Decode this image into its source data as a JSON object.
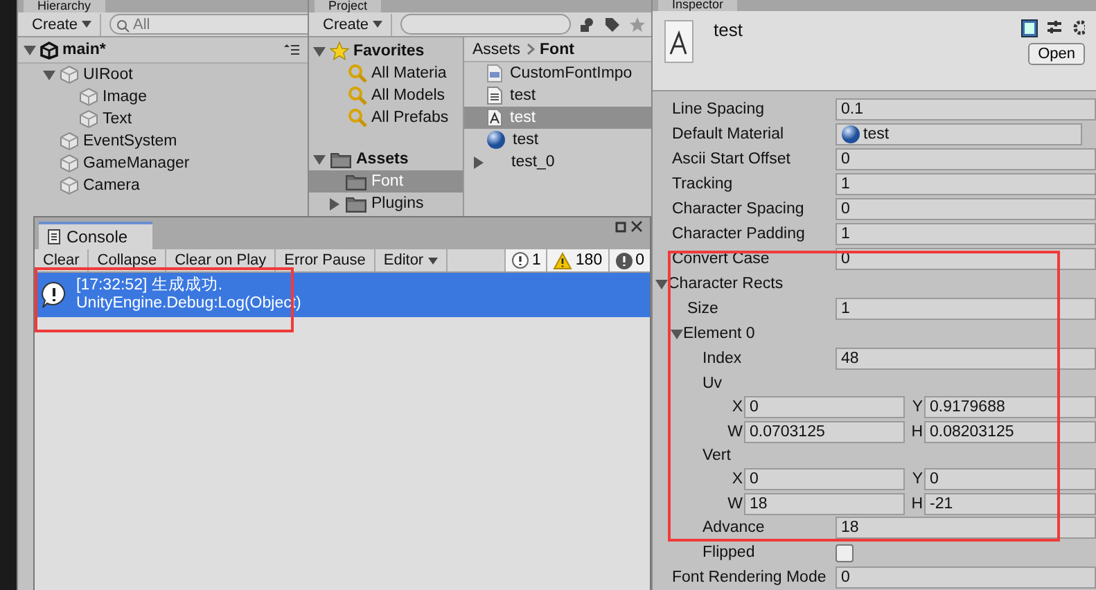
{
  "hierarchy": {
    "tab": "Hierarchy",
    "create": "Create",
    "search_placeholder": "All",
    "scene": "main*",
    "items": [
      {
        "label": "UIRoot",
        "expanded": true,
        "children": [
          {
            "label": "Image"
          },
          {
            "label": "Text"
          }
        ]
      },
      {
        "label": "EventSystem"
      },
      {
        "label": "GameManager"
      },
      {
        "label": "Camera"
      }
    ]
  },
  "project": {
    "tab": "Project",
    "create": "Create",
    "favorites": {
      "label": "Favorites",
      "expanded": true,
      "items": [
        "All Materia",
        "All Models",
        "All Prefabs"
      ]
    },
    "assets": {
      "label": "Assets",
      "expanded": true,
      "children": [
        {
          "label": "Font",
          "selected": true
        },
        {
          "label": "Plugins",
          "selected": false
        }
      ]
    },
    "breadcrumb": [
      "Assets",
      "Font"
    ],
    "files": [
      {
        "kind": "script",
        "name": "CustomFontImpo",
        "selected": false
      },
      {
        "kind": "text",
        "name": "test",
        "selected": false
      },
      {
        "kind": "font",
        "name": "test",
        "selected": true
      },
      {
        "kind": "material",
        "name": "test",
        "selected": false
      },
      {
        "kind": "sprite",
        "name": "test_0",
        "selected": false
      }
    ]
  },
  "inspector": {
    "tab": "Inspector",
    "title": "test",
    "open": "Open",
    "rows": [
      {
        "kind": "field",
        "label": "Line Spacing",
        "value": "0.1"
      },
      {
        "kind": "object",
        "label": "Default Material",
        "value": "test"
      },
      {
        "kind": "field",
        "label": "Ascii Start Offset",
        "value": "0"
      },
      {
        "kind": "field",
        "label": "Tracking",
        "value": "1"
      },
      {
        "kind": "field",
        "label": "Character Spacing",
        "value": "0"
      },
      {
        "kind": "field",
        "label": "Character Padding",
        "value": "1"
      },
      {
        "kind": "field",
        "label": "Convert Case",
        "value": "0"
      },
      {
        "kind": "foldout",
        "label": "Character Rects",
        "expanded": true,
        "children": [
          {
            "kind": "field",
            "label": "Size",
            "value": "1"
          },
          {
            "kind": "foldout",
            "label": "Element 0",
            "expanded": true,
            "children": [
              {
                "kind": "field",
                "label": "Index",
                "value": "48"
              },
              {
                "kind": "rect",
                "label": "Uv",
                "fields": [
                  {
                    "axis": "X",
                    "value": "0"
                  },
                  {
                    "axis": "Y",
                    "value": "0.9179688"
                  },
                  {
                    "axis": "W",
                    "value": "0.0703125"
                  },
                  {
                    "axis": "H",
                    "value": "0.08203125"
                  }
                ]
              },
              {
                "kind": "rect",
                "label": "Vert",
                "fields": [
                  {
                    "axis": "X",
                    "value": "0"
                  },
                  {
                    "axis": "Y",
                    "value": "0"
                  },
                  {
                    "axis": "W",
                    "value": "18"
                  },
                  {
                    "axis": "H",
                    "value": "-21"
                  }
                ]
              },
              {
                "kind": "field",
                "label": "Advance",
                "value": "18"
              },
              {
                "kind": "checkbox",
                "label": "Flipped",
                "checked": false
              }
            ]
          }
        ]
      },
      {
        "kind": "field",
        "label": "Font Rendering Mode",
        "value": "0"
      }
    ]
  },
  "console": {
    "tab": "Console",
    "buttons": [
      {
        "label": "Clear",
        "dropdown": false
      },
      {
        "label": "Collapse",
        "dropdown": false
      },
      {
        "label": "Clear on Play",
        "dropdown": false
      },
      {
        "label": "Error Pause",
        "dropdown": false
      },
      {
        "label": "Editor",
        "dropdown": true
      }
    ],
    "counters": [
      {
        "kind": "info",
        "count": "1"
      },
      {
        "kind": "warning",
        "count": "180"
      },
      {
        "kind": "error",
        "count": "0"
      }
    ],
    "entries": [
      {
        "kind": "info",
        "selected": true,
        "lines": [
          "[17:32:52] 生成成功.",
          "UnityEngine.Debug:Log(Object)"
        ]
      }
    ]
  }
}
